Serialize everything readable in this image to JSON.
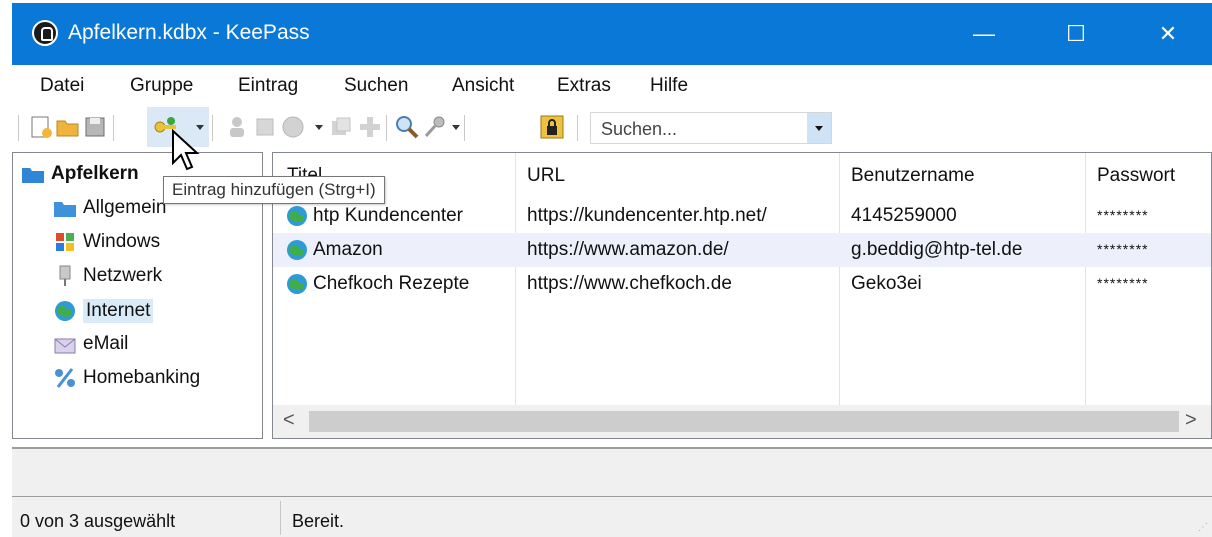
{
  "window": {
    "title": "Apfelkern.kdbx - KeePass",
    "controls": {
      "minimize": "—",
      "maximize": "☐",
      "close": "✕"
    }
  },
  "menu": [
    "Datei",
    "Gruppe",
    "Eintrag",
    "Suchen",
    "Ansicht",
    "Extras",
    "Hilfe"
  ],
  "toolbar": {
    "search_placeholder": "Suchen...",
    "tooltip": "Eintrag hinzufügen (Strg+I)"
  },
  "tree": {
    "root": "Apfelkern",
    "groups": [
      {
        "label": "Allgemein",
        "icon": "folder-icon"
      },
      {
        "label": "Windows",
        "icon": "windows-icon"
      },
      {
        "label": "Netzwerk",
        "icon": "network-icon"
      },
      {
        "label": "Internet",
        "icon": "globe-icon",
        "selected": true
      },
      {
        "label": "eMail",
        "icon": "mail-icon"
      },
      {
        "label": "Homebanking",
        "icon": "percent-icon"
      }
    ]
  },
  "entries": {
    "columns": [
      "Titel",
      "URL",
      "Benutzername",
      "Passwort"
    ],
    "rows": [
      {
        "title": "htp Kundencenter",
        "url": "https://kundencenter.htp.net/",
        "user": "4145259000",
        "password": "********"
      },
      {
        "title": "Amazon",
        "url": "https://www.amazon.de/",
        "user": "g.beddig@htp-tel.de",
        "password": "********"
      },
      {
        "title": "Chefkoch Rezepte",
        "url": "https://www.chefkoch.de",
        "user": "Geko3ei",
        "password": "********"
      }
    ],
    "scroll_left": "<",
    "scroll_right": ">"
  },
  "status": {
    "selection": "0 von 3 ausgewählt",
    "state": "Bereit."
  },
  "colors": {
    "titlebar": "#0a78d7",
    "selection": "#d9ebf9"
  }
}
